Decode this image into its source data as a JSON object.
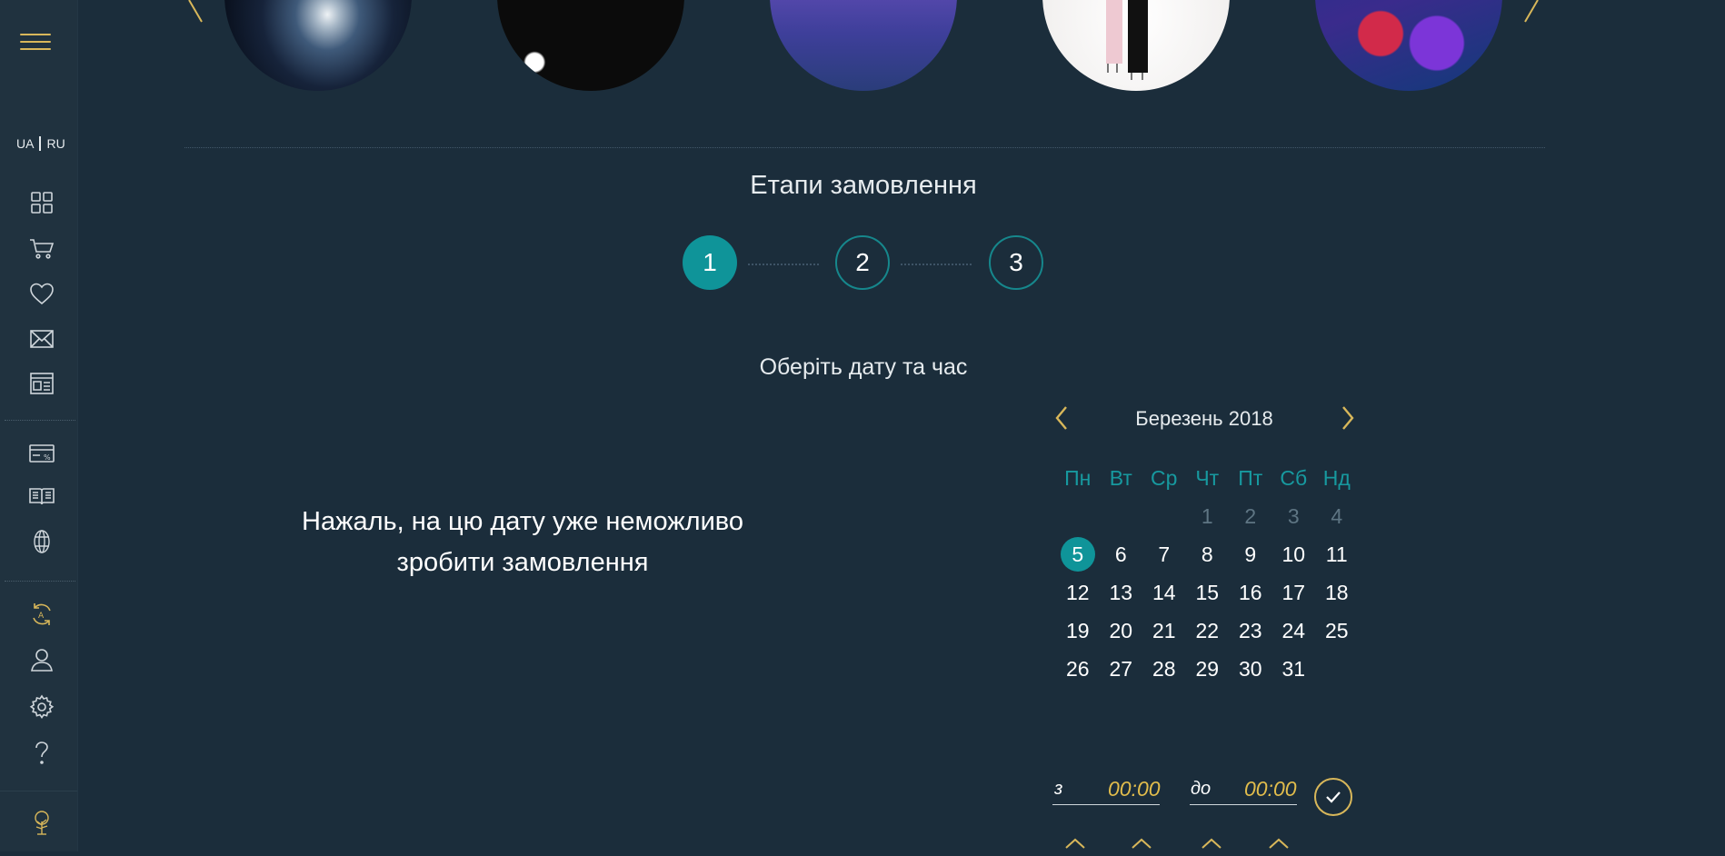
{
  "sidebar": {
    "lang": {
      "ua": "UA",
      "ru": "RU"
    },
    "icons": [
      "menu-icon",
      "grid-icon",
      "cart-icon",
      "heart-icon",
      "envelope-icon",
      "layout-icon",
      "card-discount-icon",
      "book-icon",
      "sphere-icon",
      "refresh-a-icon",
      "user-icon",
      "gear-icon",
      "help-icon",
      "tree-icon"
    ]
  },
  "order": {
    "title": "Етапи замовлення",
    "steps": [
      "1",
      "2",
      "3"
    ],
    "subtitle": "Оберіть дату та час",
    "message": "Нажаль, на цю дату уже неможливо зробити замовлення"
  },
  "calendar": {
    "month": "Березень 2018",
    "weekdays": [
      "Пн",
      "Вт",
      "Ср",
      "Чт",
      "Пт",
      "Сб",
      "Нд"
    ],
    "weeks": [
      [
        "",
        "",
        "",
        "1",
        "2",
        "3",
        "4"
      ],
      [
        "5",
        "6",
        "7",
        "8",
        "9",
        "10",
        "11"
      ],
      [
        "12",
        "13",
        "14",
        "15",
        "16",
        "17",
        "18"
      ],
      [
        "19",
        "20",
        "21",
        "22",
        "23",
        "24",
        "25"
      ],
      [
        "26",
        "27",
        "28",
        "29",
        "30",
        "31",
        ""
      ]
    ],
    "selected": "5"
  },
  "time": {
    "from_label": "з",
    "from_value": "00:00",
    "to_label": "до",
    "to_value": "00:00"
  },
  "colors": {
    "background": "#1b2d3b",
    "accent_teal": "#0f9499",
    "accent_gold": "#d8b75a",
    "time_value": "#e2bd4c"
  }
}
